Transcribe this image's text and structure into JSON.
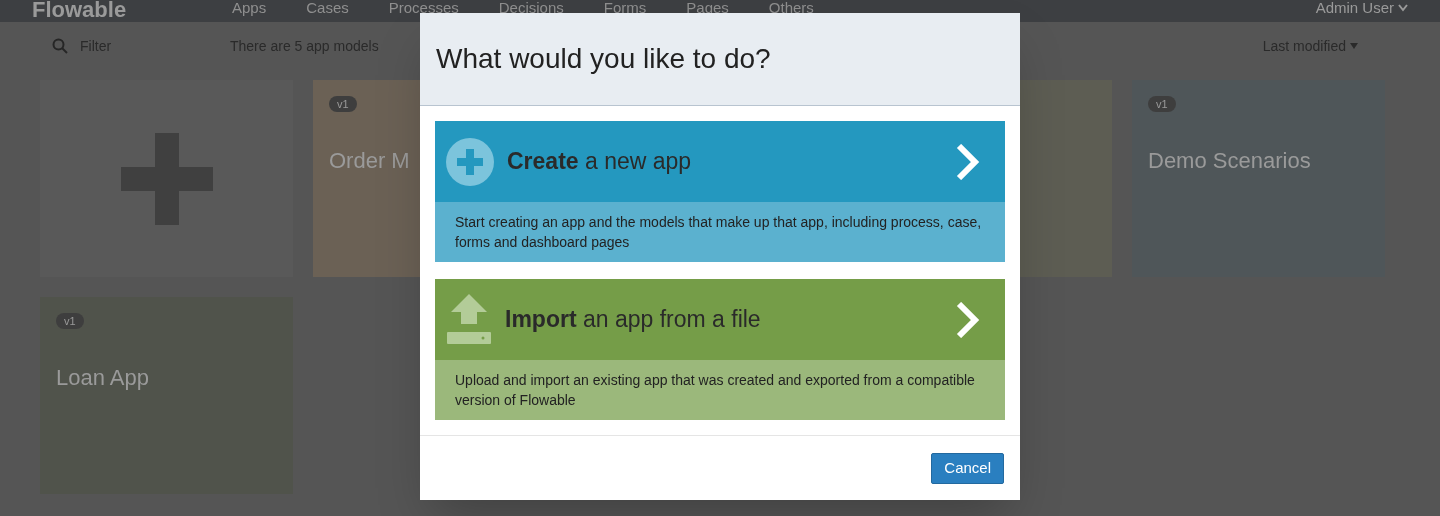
{
  "header": {
    "logo": "Flowable",
    "nav": [
      "Apps",
      "Cases",
      "Processes",
      "Decisions",
      "Forms",
      "Pages",
      "Others"
    ],
    "user": "Admin User"
  },
  "toolbar": {
    "filter": {
      "placeholder": "Filter"
    },
    "summary": "There are 5 app models",
    "sort": "Last modified"
  },
  "cards": [
    {
      "kind": "add"
    },
    {
      "kind": "app-cut-right",
      "version": "v1",
      "title": "Order M",
      "color": "#6b6155"
    },
    {
      "kind": "hidden"
    },
    {
      "kind": "app-cut-left",
      "color": "#5d5d53"
    },
    {
      "kind": "app",
      "version": "v1",
      "title": "Demo Scenarios",
      "color": "#4f5659"
    },
    {
      "kind": "app",
      "version": "v1",
      "title": "Loan App",
      "color": "#50534b"
    }
  ],
  "dialog": {
    "title": "What would you like to do?",
    "options": [
      {
        "kind": "create",
        "heading": "**Create** a new app",
        "description": "Start creating an app and the models that make up that app, including process, case, forms and dashboard pages"
      },
      {
        "kind": "import",
        "heading": "**Import** an app from a file",
        "description": "Upload and import an existing app that was created and exported from a compatible version of Flowable"
      }
    ],
    "buttons": [
      "Cancel"
    ]
  }
}
